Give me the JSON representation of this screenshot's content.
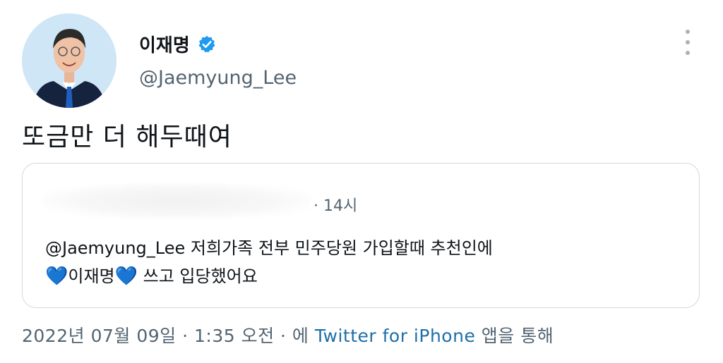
{
  "author": {
    "display_name": "이재명",
    "handle": "@Jaemyung_Lee",
    "verified_icon": "verified-badge-icon",
    "avatar_icon": "avatar-photo"
  },
  "more_icon": "more-options-icon",
  "tweet": {
    "text": "또금만 더 해두때여"
  },
  "quote": {
    "time": "· 14시",
    "mention": "@Jaemyung_Lee",
    "body_line1": "저희가족 전부 민주당원 가입할때 추천인에",
    "heart": "💙",
    "name": "이재명",
    "body_line2_rest": "쓰고 입당했어요"
  },
  "footer": {
    "date": "2022년 07월 09일",
    "sep1": " · ",
    "time": "1:35 오전",
    "sep2": " · 에 ",
    "source": "Twitter for iPhone",
    "suffix": " 앱을 통해"
  },
  "colors": {
    "accent": "#1d9bf0",
    "secondary_text": "#536471",
    "border": "#cfd9de"
  }
}
